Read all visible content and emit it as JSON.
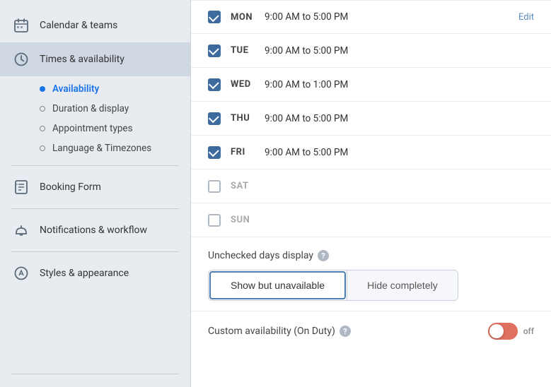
{
  "sidebar": {
    "items": [
      {
        "id": "calendar-teams",
        "label": "Calendar & teams",
        "icon": "calendar"
      },
      {
        "id": "times-availability",
        "label": "Times & availability",
        "icon": "clock",
        "active": true
      }
    ],
    "subitems": [
      {
        "id": "availability",
        "label": "Availability",
        "dot": "filled",
        "active": true
      },
      {
        "id": "duration-display",
        "label": "Duration & display",
        "dot": "empty"
      },
      {
        "id": "appointment-types",
        "label": "Appointment types",
        "dot": "empty"
      },
      {
        "id": "language-timezones",
        "label": "Language & Timezones",
        "dot": "empty"
      }
    ],
    "booking_form": {
      "label": "Booking Form",
      "icon": "form"
    },
    "notifications": {
      "label": "Notifications & workflow",
      "icon": "notification"
    },
    "styles": {
      "label": "Styles & appearance",
      "icon": "styles"
    }
  },
  "days": [
    {
      "id": "mon",
      "label": "MON",
      "checked": true,
      "time": "9:00 AM to 5:00 PM",
      "show_edit": true,
      "edit_label": "Edit"
    },
    {
      "id": "tue",
      "label": "TUE",
      "checked": true,
      "time": "9:00 AM to 5:00 PM",
      "show_edit": false
    },
    {
      "id": "wed",
      "label": "WED",
      "checked": true,
      "time": "9:00 AM to 1:00 PM",
      "show_edit": false
    },
    {
      "id": "thu",
      "label": "THU",
      "checked": true,
      "time": "9:00 AM to 5:00 PM",
      "show_edit": false
    },
    {
      "id": "fri",
      "label": "FRI",
      "checked": true,
      "time": "9:00 AM to 5:00 PM",
      "show_edit": false
    },
    {
      "id": "sat",
      "label": "SAT",
      "checked": false,
      "time": "",
      "show_edit": false
    },
    {
      "id": "sun",
      "label": "SUN",
      "checked": false,
      "time": "",
      "show_edit": false
    }
  ],
  "unchecked_display": {
    "title": "Unchecked days display",
    "help_tooltip": "?",
    "options": [
      {
        "id": "show-unavailable",
        "label": "Show but unavailable",
        "active": true
      },
      {
        "id": "hide-completely",
        "label": "Hide completely",
        "active": false
      }
    ]
  },
  "custom_availability": {
    "title": "Custom availability (On Duty)",
    "help_tooltip": "?",
    "toggle_state": "off"
  }
}
